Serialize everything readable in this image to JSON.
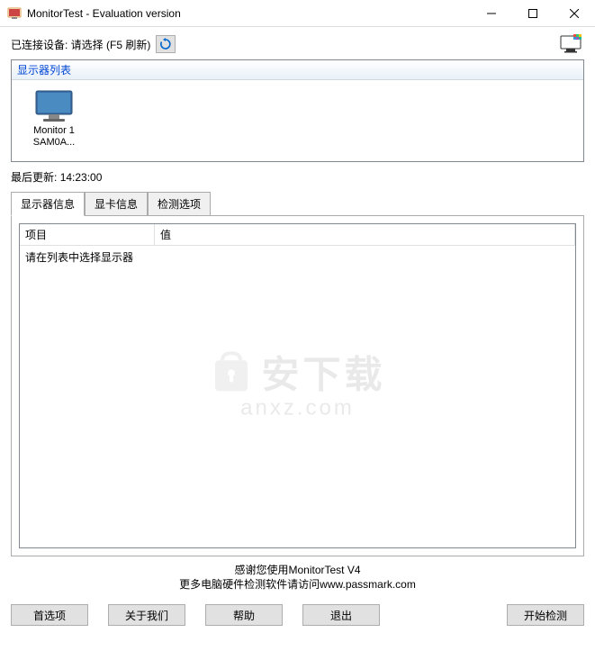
{
  "window": {
    "title": "MonitorTest - Evaluation version"
  },
  "toolbar": {
    "device_label": "已连接设备: 请选择 (F5 刷新)"
  },
  "monitor_list": {
    "header": "显示器列表",
    "items": [
      {
        "line1": "Monitor 1",
        "line2": "SAM0A..."
      }
    ]
  },
  "last_update": {
    "label": "最后更新:",
    "time": "14:23:00"
  },
  "tabs": [
    {
      "label": "显示器信息",
      "active": true
    },
    {
      "label": "显卡信息",
      "active": false
    },
    {
      "label": "检测选项",
      "active": false
    }
  ],
  "info_table": {
    "col1_header": "项目",
    "col2_header": "值",
    "placeholder": "请在列表中选择显示器"
  },
  "watermark": {
    "text": "安下载",
    "url": "anxz.com"
  },
  "footer": {
    "line1": "感谢您使用MonitorTest V4",
    "line2_prefix": "更多电脑硬件检测软件请访问",
    "line2_link": "www.passmark.com"
  },
  "buttons": {
    "preferences": "首选项",
    "about": "关于我们",
    "help": "帮助",
    "exit": "退出",
    "start": "开始检测"
  }
}
